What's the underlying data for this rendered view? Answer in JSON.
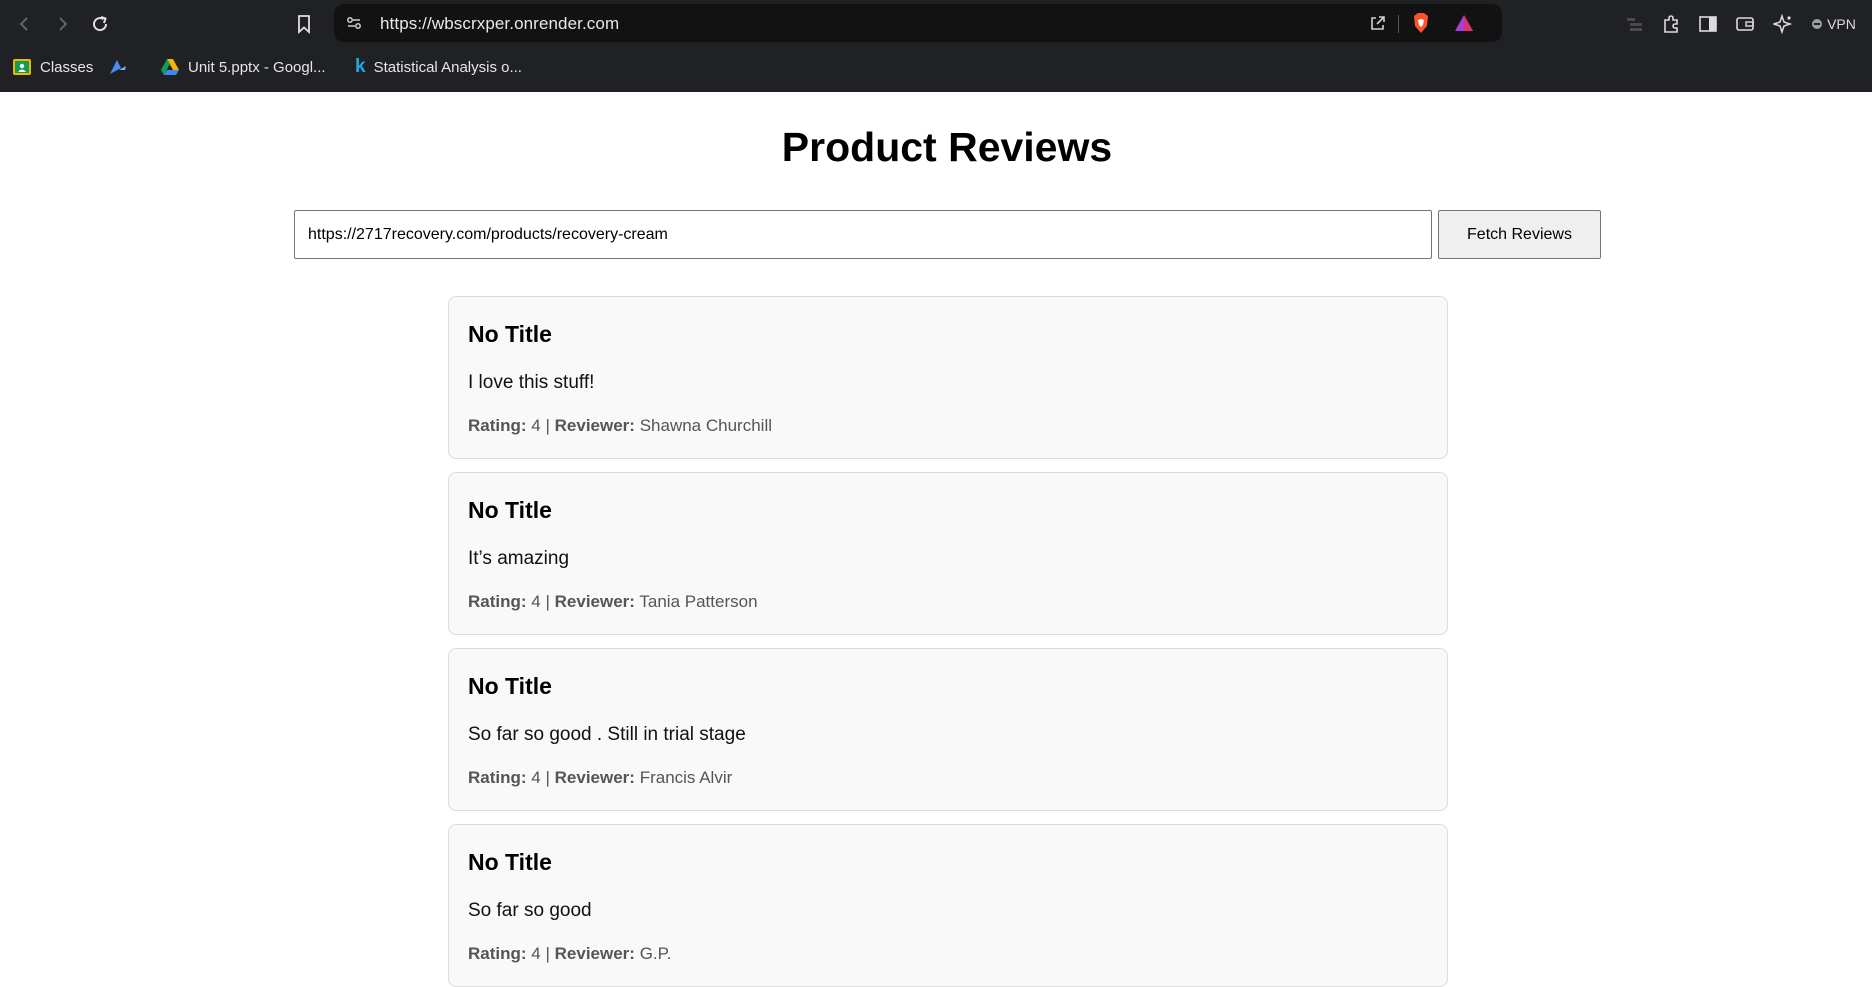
{
  "browser": {
    "url": "https://wbscrxper.onrender.com",
    "vpn_label": "VPN",
    "bookmarks": [
      {
        "label": "Classes",
        "icon": "classroom-icon"
      },
      {
        "label": "",
        "icon": "vertex-icon"
      },
      {
        "label": "Unit 5.pptx - Googl...",
        "icon": "google-drive-icon"
      },
      {
        "label": "Statistical Analysis o...",
        "icon": "k-icon"
      }
    ]
  },
  "page": {
    "title": "Product Reviews",
    "url_input_value": "https://2717recovery.com/products/recovery-cream",
    "fetch_button_label": "Fetch Reviews",
    "rating_label": "Rating:",
    "separator": "|",
    "reviewer_label": "Reviewer:"
  },
  "reviews": [
    {
      "title": "No Title",
      "body": "I love this stuff!",
      "rating": "4",
      "reviewer": "Shawna Churchill"
    },
    {
      "title": "No Title",
      "body": "It’s amazing",
      "rating": "4",
      "reviewer": "Tania Patterson"
    },
    {
      "title": "No Title",
      "body": "So far so good . Still in trial stage",
      "rating": "4",
      "reviewer": "Francis Alvir"
    },
    {
      "title": "No Title",
      "body": "So far so good",
      "rating": "4",
      "reviewer": "G.P."
    }
  ],
  "colors": {
    "chrome_bg": "#202124",
    "urlbar_bg": "#121212",
    "card_bg": "#f9f9f9",
    "card_border": "#dddddd",
    "brave_orange": "#fb542b"
  }
}
